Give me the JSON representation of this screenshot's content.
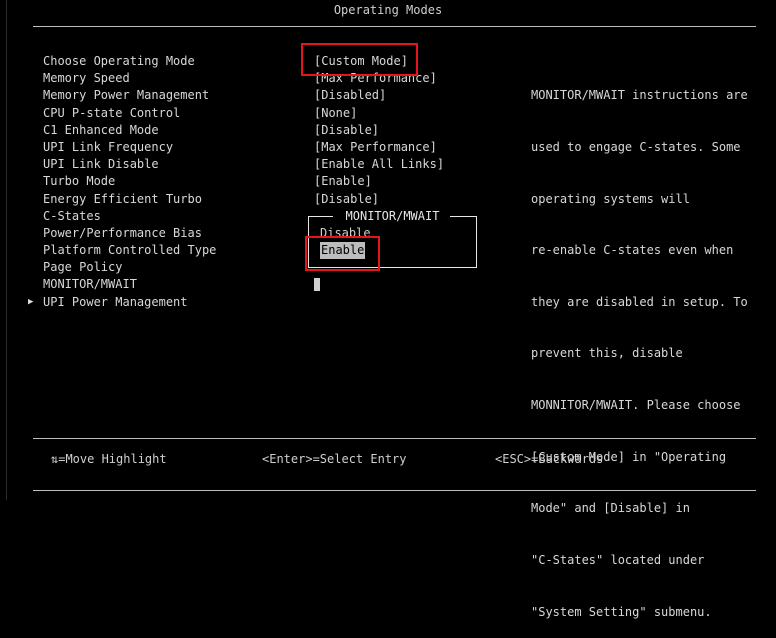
{
  "header": {
    "title": "Operating Modes"
  },
  "menu": {
    "items": [
      {
        "label": "Choose Operating Mode",
        "value": "[Custom Mode]"
      },
      {
        "label": "Memory Speed",
        "value": "[Max Performance]"
      },
      {
        "label": "Memory Power Management",
        "value": "[Disabled]"
      },
      {
        "label": "CPU P-state Control",
        "value": "[None]"
      },
      {
        "label": "C1 Enhanced Mode",
        "value": "[Disable]"
      },
      {
        "label": "UPI Link Frequency",
        "value": "[Max Performance]"
      },
      {
        "label": "UPI Link Disable",
        "value": "[Enable All Links]"
      },
      {
        "label": "Turbo Mode",
        "value": "[Enable]"
      },
      {
        "label": "Energy Efficient Turbo",
        "value": "[Disable]"
      },
      {
        "label": "C-States",
        "value": ""
      },
      {
        "label": "Power/Performance Bias",
        "value": ""
      },
      {
        "label": "Platform Controlled Type",
        "value": ""
      },
      {
        "label": "Page Policy",
        "value": ""
      },
      {
        "label": "MONITOR/MWAIT",
        "value": "["
      },
      {
        "label": "UPI Power Management",
        "value": ""
      }
    ],
    "submenu_indicator_icon": "triangle-right-icon"
  },
  "popup": {
    "title": "MONITOR/MWAIT",
    "options": [
      "Disable",
      "Enable"
    ],
    "selected": "Enable"
  },
  "help": {
    "lines": [
      "MONITOR/MWAIT instructions are",
      "used to engage C-states. Some",
      "operating systems will",
      "re-enable C-states even when",
      "they are disabled in setup. To",
      "prevent this, disable",
      "MONNITOR/MWAIT. Please choose",
      "[Custom Mode] in \"Operating",
      "Mode\" and [Disable] in",
      "\"C-States\" located under",
      "\"System Setting\" submenu."
    ]
  },
  "footer": {
    "move": "⇅=Move Highlight",
    "enter": "<Enter>=Select Entry",
    "esc": "<ESC>=Backwards"
  },
  "colors": {
    "background": "#000000",
    "text": "#d8d8d8",
    "highlight_box": "#e8141c",
    "selection_bg": "#bdbdbd"
  }
}
